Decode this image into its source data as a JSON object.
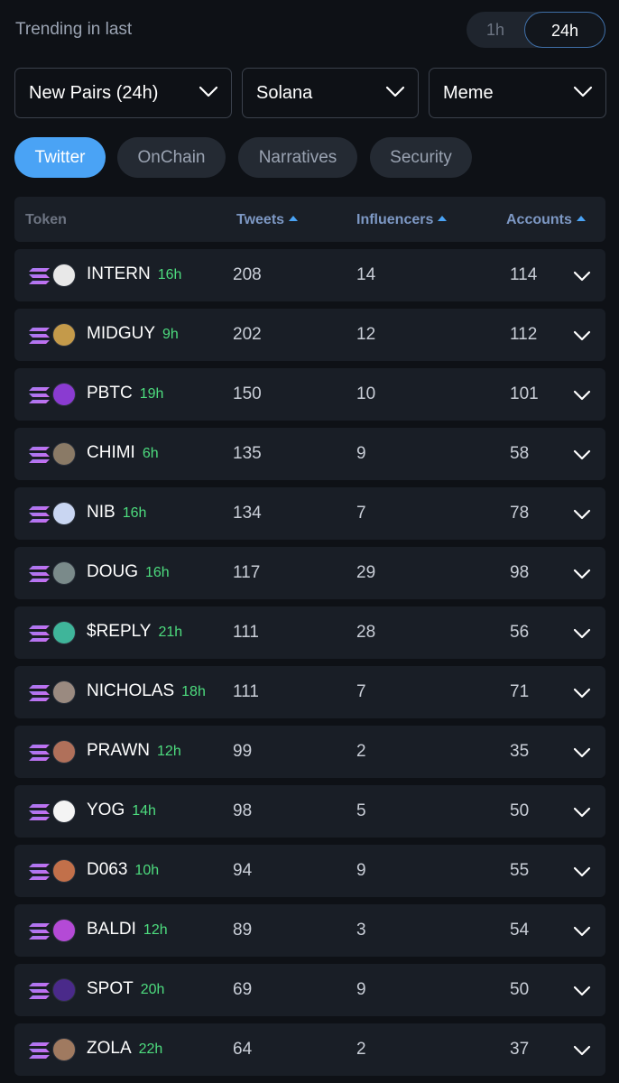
{
  "header": {
    "trending_label": "Trending in last",
    "period_options": [
      "1h",
      "24h"
    ],
    "active_period": "24h"
  },
  "filters": {
    "pairs": "New Pairs (24h)",
    "chain": "Solana",
    "category": "Meme"
  },
  "tabs": [
    {
      "label": "Twitter",
      "active": true
    },
    {
      "label": "OnChain",
      "active": false
    },
    {
      "label": "Narratives",
      "active": false
    },
    {
      "label": "Security",
      "active": false
    }
  ],
  "table": {
    "columns": {
      "token": "Token",
      "tweets": "Tweets",
      "influencers": "Influencers",
      "accounts": "Accounts"
    },
    "rows": [
      {
        "token": "INTERN",
        "age": "16h",
        "tweets": "208",
        "influencers": "14",
        "accounts": "114",
        "avatar_color": "#e8e8e8"
      },
      {
        "token": "MIDGUY",
        "age": "9h",
        "tweets": "202",
        "influencers": "12",
        "accounts": "112",
        "avatar_color": "#c49a4a"
      },
      {
        "token": "PBTC",
        "age": "19h",
        "tweets": "150",
        "influencers": "10",
        "accounts": "101",
        "avatar_color": "#8a3bd1"
      },
      {
        "token": "CHIMI",
        "age": "6h",
        "tweets": "135",
        "influencers": "9",
        "accounts": "58",
        "avatar_color": "#8a7a66"
      },
      {
        "token": "NIB",
        "age": "16h",
        "tweets": "134",
        "influencers": "7",
        "accounts": "78",
        "avatar_color": "#c9d6f2"
      },
      {
        "token": "DOUG",
        "age": "16h",
        "tweets": "117",
        "influencers": "29",
        "accounts": "98",
        "avatar_color": "#7a8a8a"
      },
      {
        "token": "$REPLY",
        "age": "21h",
        "tweets": "111",
        "influencers": "28",
        "accounts": "56",
        "avatar_color": "#3fb59a"
      },
      {
        "token": "NICHOLAS",
        "age": "18h",
        "tweets": "111",
        "influencers": "7",
        "accounts": "71",
        "avatar_color": "#9a8a80"
      },
      {
        "token": "PRAWN",
        "age": "12h",
        "tweets": "99",
        "influencers": "2",
        "accounts": "35",
        "avatar_color": "#b0705a"
      },
      {
        "token": "YOG",
        "age": "14h",
        "tweets": "98",
        "influencers": "5",
        "accounts": "50",
        "avatar_color": "#f4f4f4"
      },
      {
        "token": "D063",
        "age": "10h",
        "tweets": "94",
        "influencers": "9",
        "accounts": "55",
        "avatar_color": "#c2704a"
      },
      {
        "token": "BALDI",
        "age": "12h",
        "tweets": "89",
        "influencers": "3",
        "accounts": "54",
        "avatar_color": "#b44ad6"
      },
      {
        "token": "SPOT",
        "age": "20h",
        "tweets": "69",
        "influencers": "9",
        "accounts": "50",
        "avatar_color": "#4a2a8a"
      },
      {
        "token": "ZOLA",
        "age": "22h",
        "tweets": "64",
        "influencers": "2",
        "accounts": "37",
        "avatar_color": "#a07a60"
      }
    ]
  },
  "colors": {
    "accent": "#4aa3f5",
    "age_green": "#4ddc7e",
    "background": "#0e1116",
    "row_bg": "#191e26"
  }
}
